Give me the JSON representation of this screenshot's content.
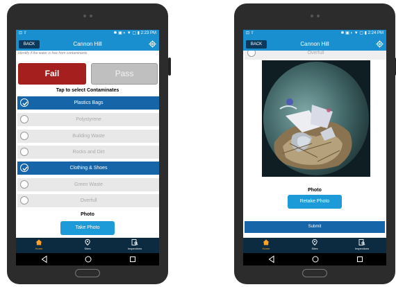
{
  "left": {
    "status": {
      "left": "⊡ ⇧",
      "right": "✱ ▣ ◐ ▼ ▢ ▮ 2:23 PM"
    },
    "appbar": {
      "back": "BACK",
      "title": "Cannon Hill"
    },
    "hint": "Identify if the water is free from contaminants",
    "fail_label": "Fail",
    "pass_label": "Pass",
    "tap_label": "Tap to select Contaminates",
    "contaminants": [
      {
        "label": "Plastics Bags",
        "selected": true
      },
      {
        "label": "Polystyrene",
        "selected": false
      },
      {
        "label": "Building Waste",
        "selected": false
      },
      {
        "label": "Rocks and Dirt",
        "selected": false
      },
      {
        "label": "Clothing & Shoes",
        "selected": true
      },
      {
        "label": "Green Waste",
        "selected": false
      },
      {
        "label": "Overfull",
        "selected": false
      }
    ],
    "photo_label": "Photo",
    "take_photo": "Take Photo",
    "nav": {
      "home": "Home",
      "sites": "Sites",
      "inspections": "Inspections"
    }
  },
  "right": {
    "status": {
      "left": "⊡ ⇧",
      "right": "✱ ▣ ◐ ▼ ▢ ▮ 2:24 PM"
    },
    "appbar": {
      "back": "BACK",
      "title": "Cannon Hill"
    },
    "overfull_label": "Overfull",
    "photo_label": "Photo",
    "retake_photo": "Retake Photo",
    "submit": "Submit",
    "nav": {
      "home": "Home",
      "sites": "Sites",
      "inspections": "Inspections"
    }
  },
  "colors": {
    "app_blue": "#1a8fcf",
    "selected_blue": "#1565a8",
    "fail_red": "#a61f1f",
    "nav_dark": "#0c2b40",
    "active_orange": "#ffa227"
  },
  "icons": {
    "gear": "gear-icon",
    "check": "checkmark-icon",
    "home": "home-icon",
    "sites": "location-pin-icon",
    "inspections": "inspection-document-icon",
    "back": "triangle-back-icon",
    "circle": "circle-home-icon",
    "square": "square-recents-icon"
  }
}
